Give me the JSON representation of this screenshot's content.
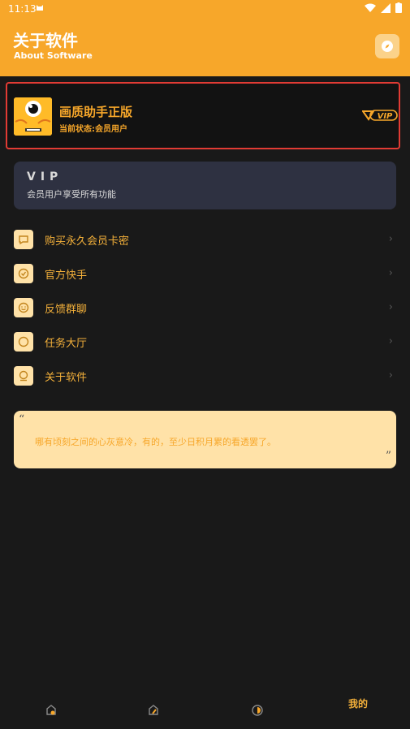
{
  "status_bar": {
    "time": "11:13"
  },
  "header": {
    "title": "关于软件",
    "subtitle": "About Software"
  },
  "profile": {
    "name": "画质助手正版",
    "state": "当前状态:会员用户",
    "badge": "VIP"
  },
  "vip_card": {
    "title": "VIP",
    "description": "会员用户享受所有功能"
  },
  "menu": {
    "items": [
      {
        "label": "购买永久会员卡密",
        "icon": "chat-icon"
      },
      {
        "label": "官方快手",
        "icon": "badge-check-icon"
      },
      {
        "label": "反馈群聊",
        "icon": "smile-icon"
      },
      {
        "label": "任务大厅",
        "icon": "circle-icon"
      },
      {
        "label": "关于软件",
        "icon": "info-icon"
      }
    ],
    "chevron": "›"
  },
  "quote": {
    "open": "“",
    "text": "哪有顷刻之间的心灰意冷，有的，至少日积月累的看透罢了。",
    "close": "”"
  },
  "tabbar": {
    "active_label": "我的"
  },
  "colors": {
    "accent": "#f7a72a",
    "background": "#191919",
    "vip_card": "#2e3141",
    "quote_bg": "#ffe2a8",
    "highlight_border": "#e13b34"
  }
}
